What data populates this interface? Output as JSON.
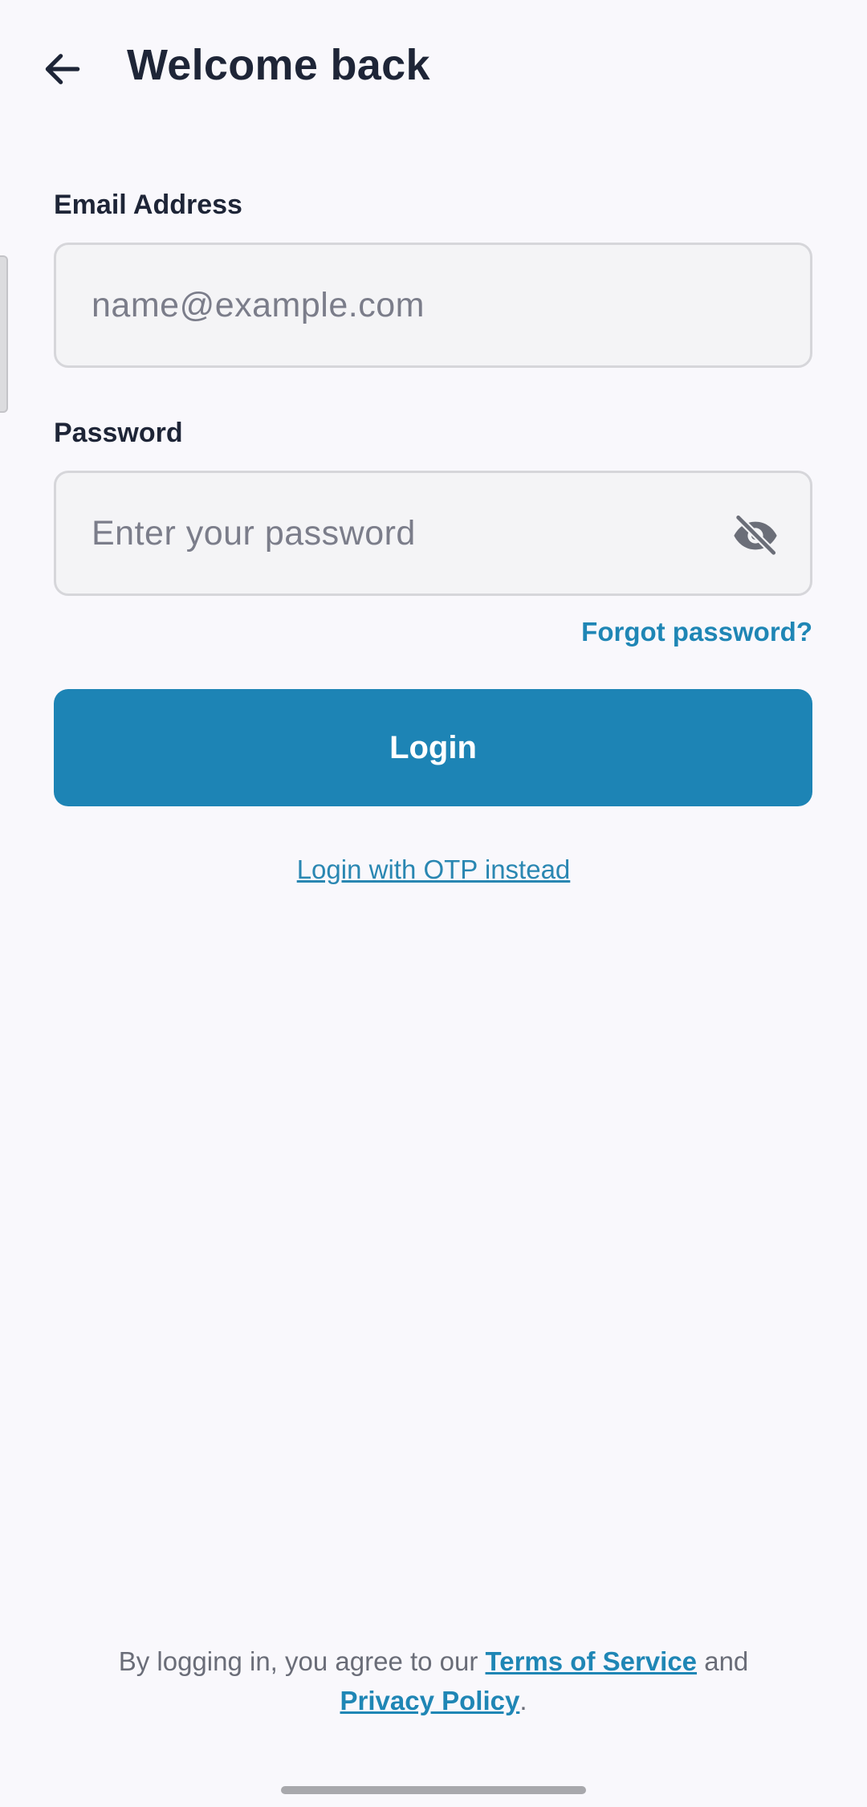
{
  "header": {
    "title": "Welcome back",
    "back_icon": "arrow-left-icon"
  },
  "form": {
    "email": {
      "label": "Email Address",
      "placeholder": "name@example.com",
      "value": ""
    },
    "password": {
      "label": "Password",
      "placeholder": "Enter your password",
      "value": "",
      "toggle_icon": "eye-off-icon"
    },
    "forgot_password": "Forgot password?",
    "login_button": "Login",
    "otp_link": "Login with OTP instead"
  },
  "footer": {
    "prefix": "By logging in, you agree to our ",
    "terms": "Terms of Service",
    "middle": " and",
    "privacy": "Privacy Policy",
    "suffix": "."
  },
  "colors": {
    "accent": "#1d84b5",
    "background": "#f9f8fc",
    "text": "#1e2537"
  }
}
